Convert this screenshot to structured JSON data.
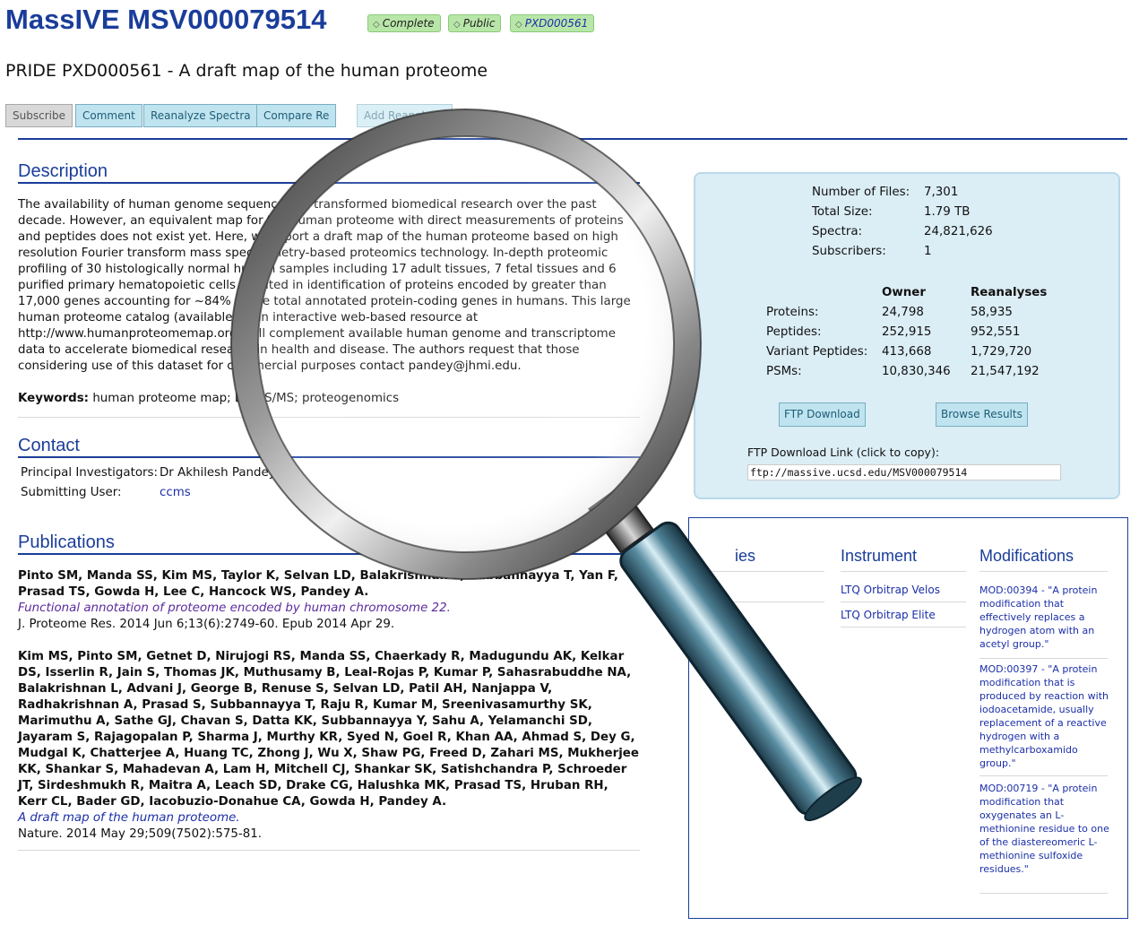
{
  "header": {
    "title": "MassIVE MSV000079514",
    "badges": [
      "Complete",
      "Public",
      "PXD000561"
    ],
    "subtitle": "PRIDE PXD000561 - A draft map of the human proteome"
  },
  "toolbar": {
    "subscribe": "Subscribe",
    "comment": "Comment",
    "reanalyze": "Reanalyze Spectra",
    "compare": "Compare Re",
    "add_reanalysis": "Add Reanalysis"
  },
  "description": {
    "heading": "Description",
    "text": "The availability of human genome sequence has transformed biomedical research over the past decade. However, an equivalent map for the human proteome with direct measurements of proteins and peptides does not exist yet. Here, we report a draft map of the human proteome based on high resolution Fourier transform mass spectrometry-based proteomics technology. In-depth proteomic profiling of 30 histologically normal human samples including 17 adult tissues, 7 fetal tissues and 6 purified primary hematopoietic cells resulted in identification of proteins encoded by greater than 17,000 genes accounting for ~84% of the total annotated protein-coding genes in humans. This large human proteome catalog (available as an interactive web-based resource at http://www.humanproteomemap.org) will complement available human genome and transcriptome data to accelerate biomedical research in health and disease. The authors request that those considering use of this dataset for commercial purposes contact pandey@jhmi.edu.",
    "keywords_label": "Keywords:",
    "keywords": "human proteome map; LC-MS/MS; proteogenomics"
  },
  "contact": {
    "heading": "Contact",
    "pi_label": "Principal Investigators:",
    "pi_value": "Dr Akhilesh Pandey",
    "submitter_label": "Submitting User:",
    "submitter_value": "ccms"
  },
  "publications": {
    "heading": "Publications",
    "items": [
      {
        "authors": "Pinto SM, Manda SS, Kim MS, Taylor K, Selvan LD, Balakrishnan L, Subbannayya T, Yan F, Prasad TS, Gowda H, Lee C, Hancock WS, Pandey A.",
        "title": "Functional annotation of proteome encoded by human chromosome 22.",
        "citation": "J. Proteome Res. 2014 Jun 6;13(6):2749-60. Epub 2014 Apr 29."
      },
      {
        "authors": "Kim MS, Pinto SM, Getnet D, Nirujogi RS, Manda SS, Chaerkady R, Madugundu AK, Kelkar DS, Isserlin R, Jain S, Thomas JK, Muthusamy B, Leal-Rojas P, Kumar P, Sahasrabuddhe NA, Balakrishnan L, Advani J, George B, Renuse S, Selvan LD, Patil AH, Nanjappa V, Radhakrishnan A, Prasad S, Subbannayya T, Raju R, Kumar M, Sreenivasamurthy SK, Marimuthu A, Sathe GJ, Chavan S, Datta KK, Subbannayya Y, Sahu A, Yelamanchi SD, Jayaram S, Rajagopalan P, Sharma J, Murthy KR, Syed N, Goel R, Khan AA, Ahmad S, Dey G, Mudgal K, Chatterjee A, Huang TC, Zhong J, Wu X, Shaw PG, Freed D, Zahari MS, Mukherjee KK, Shankar S, Mahadevan A, Lam H, Mitchell CJ, Shankar SK, Satishchandra P, Schroeder JT, Sirdeshmukh R, Maitra A, Leach SD, Drake CG, Halushka MK, Prasad TS, Hruban RH, Kerr CL, Bader GD, Iacobuzio-Donahue CA, Gowda H, Pandey A.",
        "title": "A draft map of the human proteome.",
        "citation": "Nature. 2014 May 29;509(7502):575-81."
      }
    ]
  },
  "stats": {
    "files_label": "Number of Files:",
    "files_value": "7,301",
    "size_label": "Total Size:",
    "size_value": "1.79 TB",
    "spectra_label": "Spectra:",
    "spectra_value": "24,821,626",
    "subs_label": "Subscribers:",
    "subs_value": "1",
    "col_owner": "Owner",
    "col_reanalyses": "Reanalyses",
    "rows": [
      {
        "label": "Proteins:",
        "owner": "24,798",
        "re": "58,935"
      },
      {
        "label": "Peptides:",
        "owner": "252,915",
        "re": "952,551"
      },
      {
        "label": "Variant Peptides:",
        "owner": "413,668",
        "re": "1,729,720"
      },
      {
        "label": "PSMs:",
        "owner": "10,830,346",
        "re": "21,547,192"
      }
    ],
    "ftp_button": "FTP Download",
    "browse_button": "Browse Results",
    "ftp_link_label": "FTP Download Link (click to copy):",
    "ftp_link_value": "ftp://massive.ucsd.edu/MSV000079514"
  },
  "lower": {
    "species_heading": "ies",
    "instrument_heading": "Instrument",
    "modifications_heading": "Modifications",
    "instruments": [
      "LTQ Orbitrap Velos",
      "LTQ Orbitrap Elite"
    ],
    "mods": [
      "MOD:00394 - \"A protein modification that effectively replaces a hydrogen atom with an acetyl group.\"",
      "MOD:00397 - \"A protein modification that is produced by reaction with iodoacetamide, usually replacement of a reactive hydrogen with a methylcarboxamido group.\"",
      "MOD:00719 - \"A protein modification that oxygenates an L-methionine residue to one of the diastereomeric L-methionine sulfoxide residues.\""
    ]
  },
  "colors": {
    "heading_blue": "#1a3d9a",
    "badge_green": "#b8e6a8",
    "panel_bg": "#dbedf5",
    "button_bg": "#bfe4ef"
  },
  "overlay_icon": "magnifying-glass-icon"
}
